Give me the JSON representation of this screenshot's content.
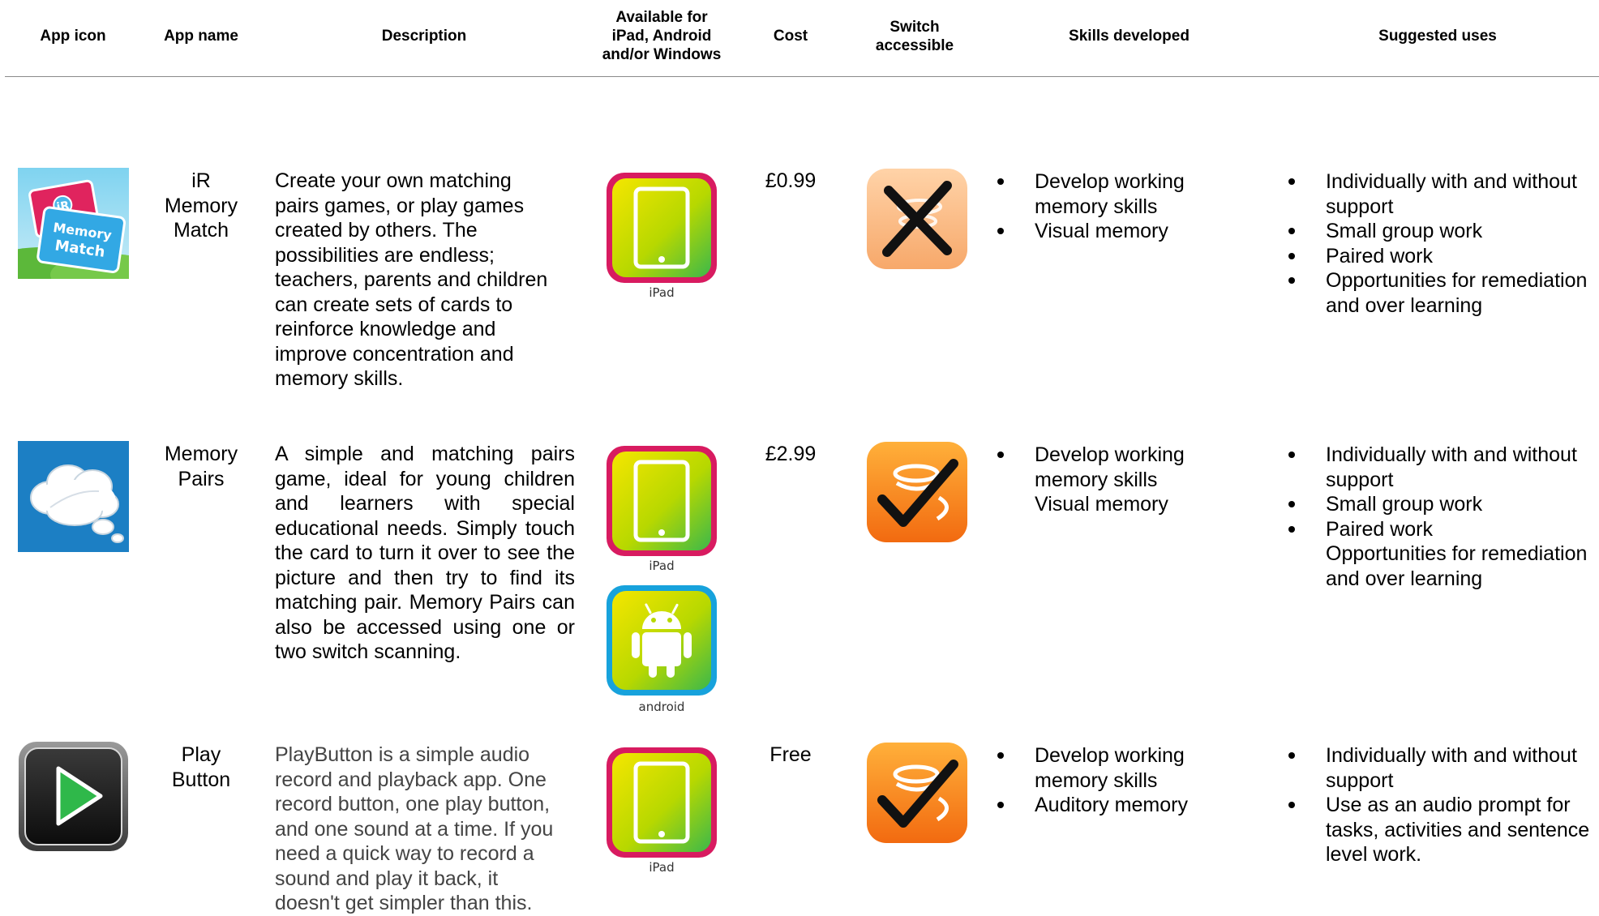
{
  "headers": {
    "icon": "App icon",
    "name": "App name",
    "description": "Description",
    "platforms": [
      "Available for",
      "iPad, Android",
      "and/or Windows"
    ],
    "cost": "Cost",
    "switch": [
      "Switch",
      "accessible"
    ],
    "skills": "Skills developed",
    "uses": "Suggested uses"
  },
  "rows": [
    {
      "icon": "memory-match-icon",
      "name": [
        "iR",
        "Memory",
        "Match"
      ],
      "description": [
        "Create your own matching",
        "pairs games, or play games",
        "created by others. The",
        "possibilities are endless;",
        "teachers, parents and children",
        "can create sets of cards to",
        "reinforce knowledge and",
        "improve concentration and",
        "memory skills."
      ],
      "platforms": [
        "iPad"
      ],
      "cost": "£0.99",
      "switch_accessible": false,
      "skills": [
        "Develop working memory skills",
        "Visual memory"
      ],
      "uses": [
        "Individually with and without support",
        "Small group work",
        "Paired work",
        "Opportunities for remediation and over learning"
      ]
    },
    {
      "icon": "memory-pairs-cloud-icon",
      "name": [
        "Memory",
        "Pairs"
      ],
      "description": "A simple and matching pairs game, ideal for young children and learners with special educational needs. Simply touch the card to turn it over to see the picture and then try to find its matching pair. Memory Pairs can also be accessed using one or two switch scanning.",
      "platforms": [
        "iPad",
        "android"
      ],
      "cost": "£2.99",
      "switch_accessible": true,
      "skills": [
        "Develop working memory skills",
        "Visual memory"
      ],
      "uses": [
        "Individually with and without support",
        "Small group work",
        "Paired work",
        "Opportunities for remediation and over learning"
      ]
    },
    {
      "icon": "play-button-icon",
      "name": [
        "Play",
        "Button"
      ],
      "description": [
        "PlayButton is a simple audio",
        "record and playback app. One",
        "record button, one play button,",
        "and one sound at a time. If you",
        "need a quick way to record a",
        "sound and play it back, it",
        "doesn't get simpler than this."
      ],
      "platforms": [
        "iPad"
      ],
      "cost": "Free",
      "switch_accessible": true,
      "skills": [
        "Develop working memory skills",
        "Auditory memory"
      ],
      "uses": [
        "Individually with and without support",
        "Use as an audio prompt for tasks, activities and sentence level work."
      ]
    }
  ],
  "app_icon_labels": {
    "badge": "iR",
    "card_line1": "Memory",
    "card_line2": "Match"
  }
}
